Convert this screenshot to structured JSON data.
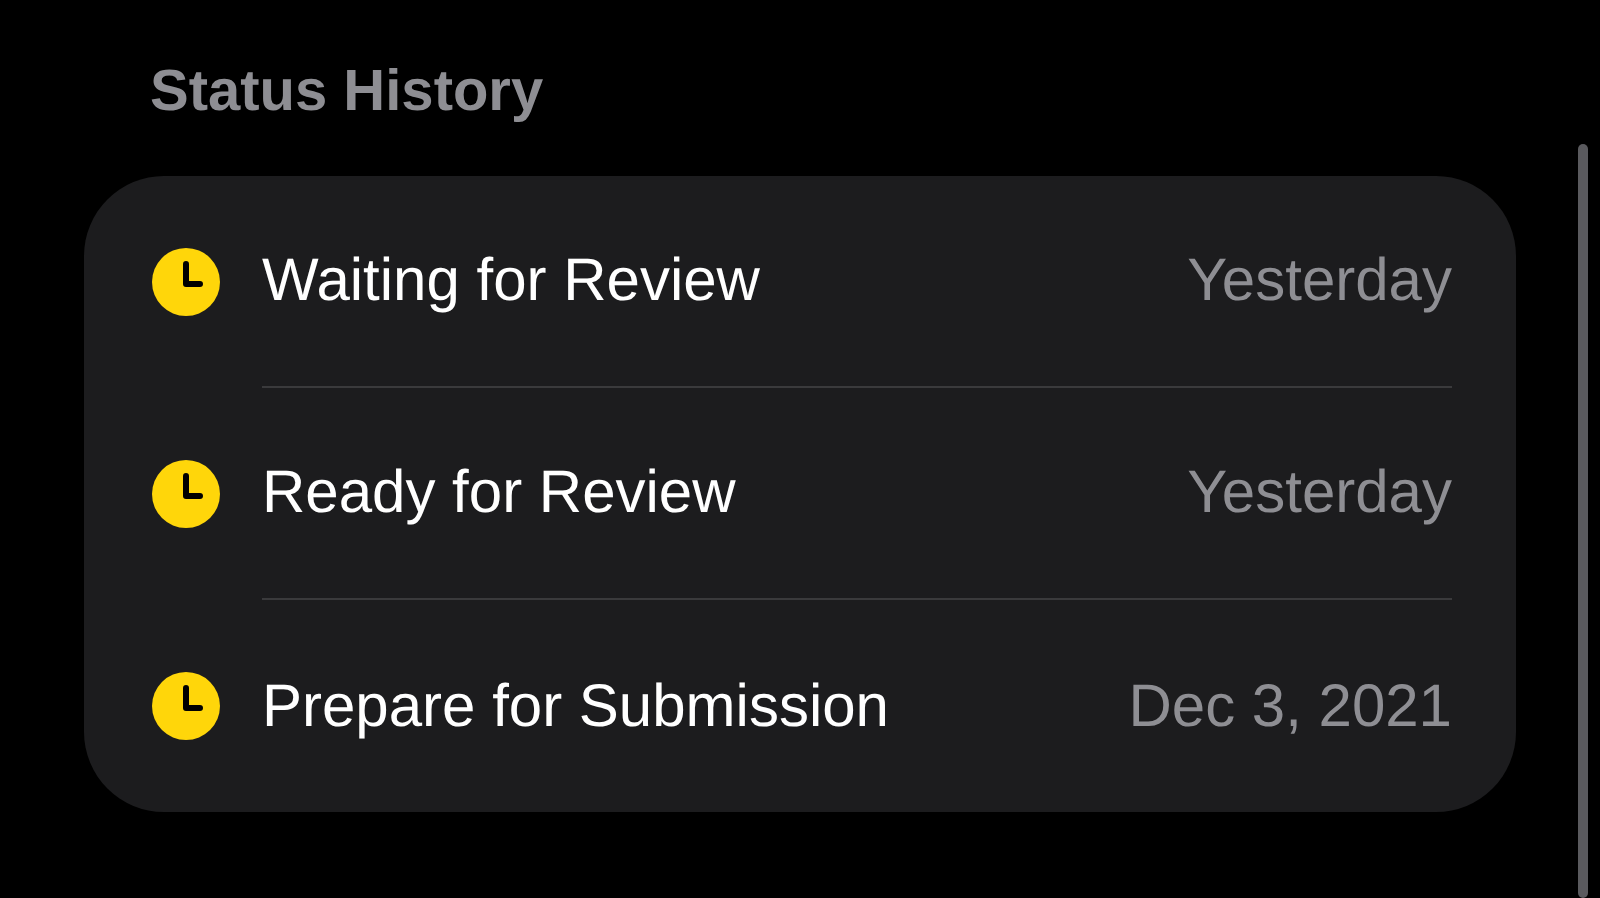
{
  "section": {
    "title": "Status History"
  },
  "history": [
    {
      "status": "Waiting for Review",
      "date": "Yesterday",
      "color": "#ffd60a"
    },
    {
      "status": "Ready for Review",
      "date": "Yesterday",
      "color": "#ffd60a"
    },
    {
      "status": "Prepare for Submission",
      "date": "Dec 3, 2021",
      "color": "#ffd60a"
    }
  ]
}
